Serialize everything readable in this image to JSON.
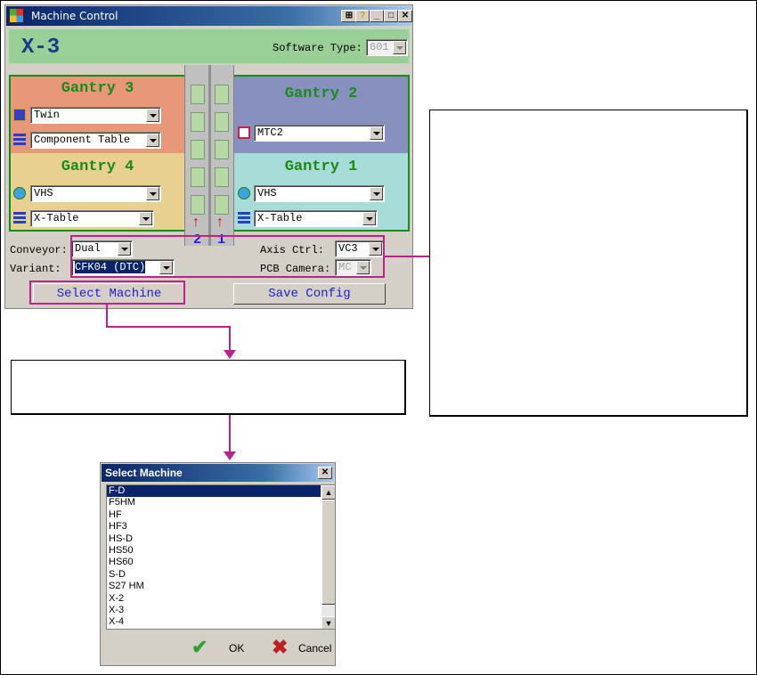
{
  "window": {
    "title": "Machine Control",
    "machine_name": "X-3",
    "software_type_label": "Software Type:",
    "software_type_value": "601"
  },
  "gantries": {
    "g3": {
      "title": "Gantry 3",
      "head": "Twin",
      "feeder": "Component Table",
      "color": "#e89878"
    },
    "g2": {
      "title": "Gantry 2",
      "head": "MTC2",
      "color": "#8890c0"
    },
    "g4": {
      "title": "Gantry 4",
      "head": "VHS",
      "feeder": "X-Table",
      "color": "#e8d090"
    },
    "g1": {
      "title": "Gantry 1",
      "head": "VHS",
      "feeder": "X-Table",
      "color": "#a8dcd8"
    }
  },
  "lanes": {
    "left": "2",
    "right": "1"
  },
  "settings": {
    "conveyor_label": "Conveyor:",
    "conveyor_value": "Dual",
    "variant_label": "Variant:",
    "variant_value": "CFK04 (DTC)",
    "axis_ctrl_label": "Axis Ctrl:",
    "axis_ctrl_value": "VC3",
    "pcb_camera_label": "PCB Camera:",
    "pcb_camera_value": "MC"
  },
  "buttons": {
    "select_machine": "Select Machine",
    "save_config": "Save Config"
  },
  "dialog": {
    "title": "Select Machine",
    "items": [
      "F-D",
      "F5HM",
      "HF",
      "HF3",
      "HS-D",
      "HS50",
      "HS60",
      "S-D",
      "S27 HM",
      "X-2",
      "X-3",
      "X-4"
    ],
    "selected_index": 0,
    "ok_label": "OK",
    "cancel_label": "Cancel"
  },
  "colors": {
    "accent_magenta": "#c0208c",
    "header_green": "#98d098",
    "frame_green": "#1a8a1a"
  }
}
